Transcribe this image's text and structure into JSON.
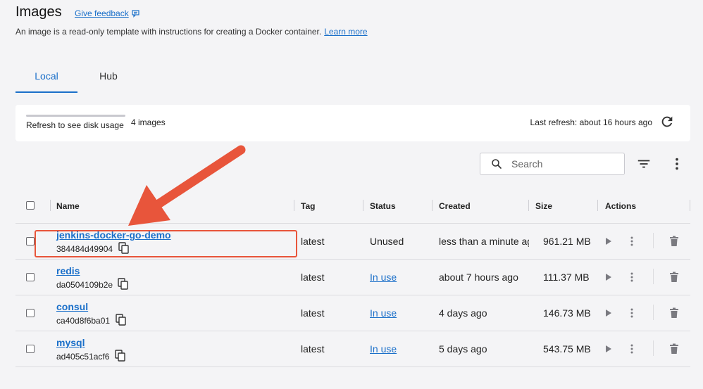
{
  "header": {
    "title": "Images",
    "feedback_label": "Give feedback",
    "subtitle": "An image is a read-only template with instructions for creating a Docker container.",
    "learn_more": "Learn more"
  },
  "tabs": [
    {
      "label": "Local",
      "active": true
    },
    {
      "label": "Hub",
      "active": false
    }
  ],
  "disk": {
    "label": "Refresh to see disk usage",
    "count": "4 images",
    "last_refresh": "Last refresh: about 16 hours ago"
  },
  "toolbar": {
    "search_placeholder": "Search",
    "icons": [
      "search-icon",
      "filter-icon",
      "more-vertical-icon"
    ]
  },
  "table": {
    "columns": [
      "Name",
      "Tag",
      "Status",
      "Created",
      "Size",
      "Actions"
    ],
    "rows": [
      {
        "name": "jenkins-docker-go-demo",
        "id": "384484d49904",
        "tag": "latest",
        "status": "Unused",
        "status_link": false,
        "created": "less than a minute ago",
        "size": "961.21 MB"
      },
      {
        "name": "redis",
        "id": "da0504109b2e",
        "tag": "latest",
        "status": "In use",
        "status_link": true,
        "created": "about 7 hours ago",
        "size": "111.37 MB"
      },
      {
        "name": "consul",
        "id": "ca40d8f6ba01",
        "tag": "latest",
        "status": "In use",
        "status_link": true,
        "created": "4 days ago",
        "size": "146.73 MB"
      },
      {
        "name": "mysql",
        "id": "ad405c51acf6",
        "tag": "latest",
        "status": "In use",
        "status_link": true,
        "created": "5 days ago",
        "size": "543.75 MB"
      }
    ]
  },
  "annotation": {
    "color": "#e8553b"
  },
  "colors": {
    "accent": "#1a6fc9",
    "background": "#f4f4f6"
  }
}
